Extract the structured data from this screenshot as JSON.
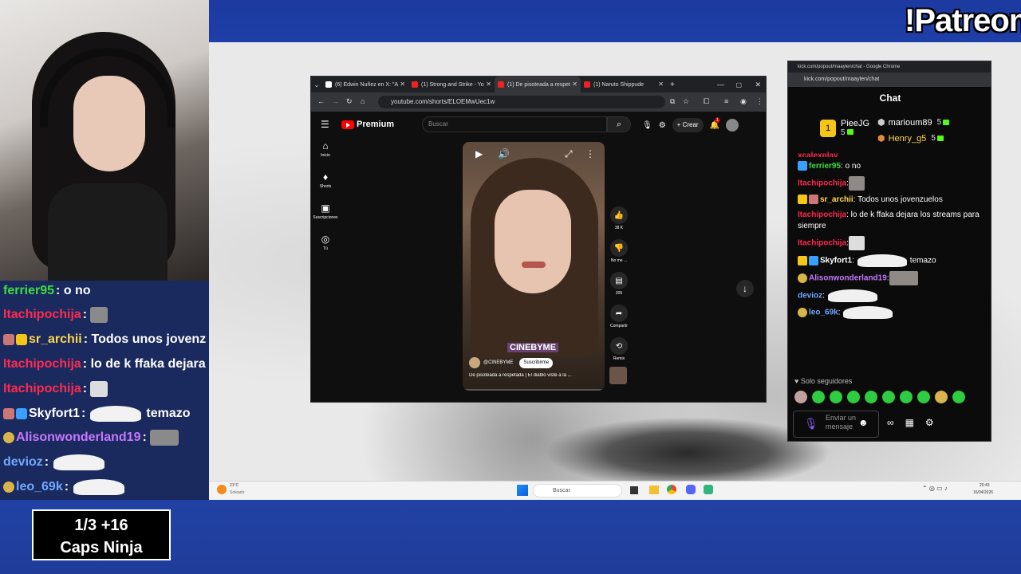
{
  "overlay": {
    "patreon": "!Patreon",
    "counter_line1": "1/3  +16",
    "counter_line2": "Caps Ninja",
    "chat": [
      {
        "user": "ferrier95",
        "color": "#3ddc3d",
        "text": ": o no",
        "emote": ""
      },
      {
        "user": "Itachipochija",
        "color": "#ff2a4f",
        "text": " : ",
        "emote": "img"
      },
      {
        "user": "sr_archii",
        "color": "#ffd84d",
        "text": " : Todos unos jovenz",
        "emote": ""
      },
      {
        "user": "Itachipochija",
        "color": "#ff2a4f",
        "text": " : lo de k ffaka dejara",
        "emote": ""
      },
      {
        "user": "Itachipochija",
        "color": "#ff2a4f",
        "text": " : ",
        "emote": "img"
      },
      {
        "user": "Skyfort1",
        "color": "#ffffff",
        "text": " : ",
        "emote": "wide",
        "after": "temazo"
      },
      {
        "user": "Alisonwonderland19",
        "color": "#c678ff",
        "text": " : ",
        "emote": "img"
      },
      {
        "user": "devioz",
        "color": "#6fa8ff",
        "text": " : ",
        "emote": "wide"
      },
      {
        "user": "leo_69k",
        "color": "#6fa8ff",
        "text": " : ",
        "emote": "wide"
      }
    ]
  },
  "browser": {
    "tabs": [
      {
        "label": "(6) Edwin Nuñez en X: \"A"
      },
      {
        "label": "(1) Strong and Strike - Yo"
      },
      {
        "label": "(1) De pisoteada a respet"
      },
      {
        "label": "(1) Naruto Shippude"
      }
    ],
    "url": "youtube.com/shorts/ELOEMwUec1w",
    "yt_brand": "Premium",
    "search_placeholder": "Buscar",
    "create_label": "+ Crear",
    "notif_count": "1",
    "nav": [
      {
        "label": "Inicio",
        "icon": "home-icon"
      },
      {
        "label": "Shorts",
        "icon": "shorts-icon"
      },
      {
        "label": "Suscripciones",
        "icon": "subscriptions-icon"
      },
      {
        "label": "Tú",
        "icon": "you-icon"
      }
    ],
    "short": {
      "brand_text": "CINEBYME",
      "channel": "@CINEBYME",
      "subscribe": "Suscribirme",
      "title": "De pisoteada a respetada | El diablo viste a la ..."
    },
    "actions": [
      {
        "label": "38 K",
        "icon": "like-icon"
      },
      {
        "label": "No me ...",
        "icon": "dislike-icon"
      },
      {
        "label": "205",
        "icon": "comment-icon"
      },
      {
        "label": "Compartir",
        "icon": "share-icon"
      },
      {
        "label": "Remix",
        "icon": "remix-icon"
      }
    ]
  },
  "kick": {
    "window_title": "kick.com/popout/maaylen/chat - Google Chrome",
    "url": "kick.com/popout/maaylen/chat",
    "title": "Chat",
    "gifters": [
      {
        "name": "PieeJG",
        "count": "5"
      },
      {
        "name": "marioum89",
        "count": "5"
      },
      {
        "name": "Henry_g5",
        "count": "5"
      }
    ],
    "messages": [
      {
        "user": "xcalexplay",
        "color": "#ff2a4f",
        "text": ""
      },
      {
        "user": "ferrier95",
        "color": "#3ddc3d",
        "text": ": o no"
      },
      {
        "user": "Itachipochija",
        "color": "#ff2a4f",
        "text": ":"
      },
      {
        "user": "sr_archii",
        "color": "#ffd84d",
        "text": ": Todos unos jovenzuelos"
      },
      {
        "user": "Itachipochija",
        "color": "#ff2a4f",
        "text": ": lo de k ffaka dejara los streams para siempre"
      },
      {
        "user": "Itachipochija",
        "color": "#ff2a4f",
        "text": ":"
      },
      {
        "user": "Skyfort1",
        "color": "#ffffff",
        "text": ":",
        "after": "temazo"
      },
      {
        "user": "Alisonwonderland19",
        "color": "#c678ff",
        "text": ":"
      },
      {
        "user": "devioz",
        "color": "#6fa8ff",
        "text": ":"
      },
      {
        "user": "leo_69k",
        "color": "#6fa8ff",
        "text": ":"
      }
    ],
    "followers_only": "Solo seguidores",
    "input_placeholder": "Enviar un mensaje"
  },
  "taskbar": {
    "weather_temp": "21°C",
    "weather_text": "Soleado",
    "search": "Buscar",
    "time": "20:43",
    "date": "16/04/2026"
  }
}
